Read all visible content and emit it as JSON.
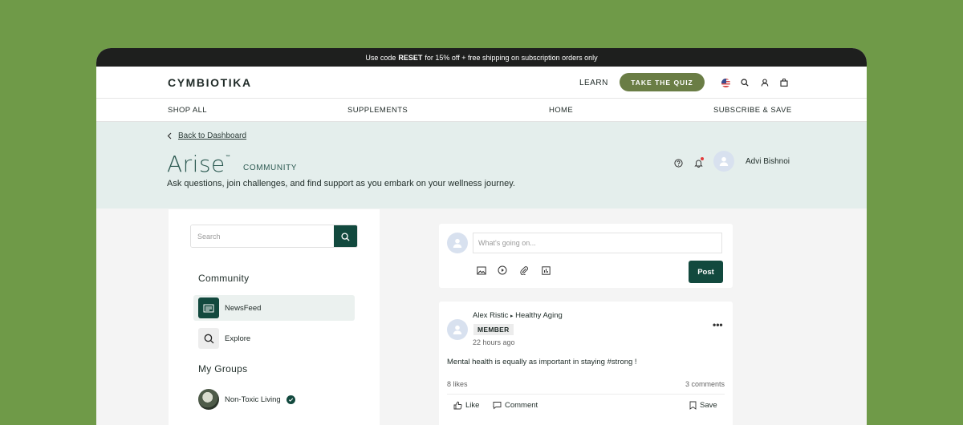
{
  "promo": {
    "before": "Use code",
    "code": "RESET",
    "after": "for 15% off + free shipping on subscription orders only"
  },
  "header": {
    "logo": "CYMBIOTIKA",
    "learn": "LEARN",
    "quiz_button": "TAKE THE QUIZ"
  },
  "nav": {
    "items": [
      "SHOP ALL",
      "SUPPLEMENTS",
      "HOME",
      "SUBSCRIBE & SAVE"
    ]
  },
  "hero": {
    "back_link": "Back to Dashboard",
    "brand": "Arise",
    "trademark": "™",
    "brand_suffix": "COMMUNITY",
    "subtitle": "Ask questions, join challenges, and find support as you embark on your wellness journey.",
    "user_name": "Advi Bishnoi"
  },
  "sidebar": {
    "search_placeholder": "Search",
    "community_heading": "Community",
    "newsfeed": "NewsFeed",
    "explore": "Explore",
    "groups_heading": "My Groups",
    "group_1": "Non-Toxic Living"
  },
  "composer": {
    "placeholder": "What's going on...",
    "post_button": "Post"
  },
  "post": {
    "author": "Alex Ristic",
    "separator": "▸",
    "group": "Healthy Aging",
    "badge": "MEMBER",
    "time": "22 hours ago",
    "more": "•••",
    "text": "Mental health is equally as important in staying #strong !",
    "likes": "8 likes",
    "comments": "3 comments",
    "like_label": "Like",
    "comment_label": "Comment",
    "save_label": "Save"
  },
  "colors": {
    "brand_green": "#12493e",
    "olive": "#6a7d45",
    "hero_bg": "#e4eeec"
  }
}
